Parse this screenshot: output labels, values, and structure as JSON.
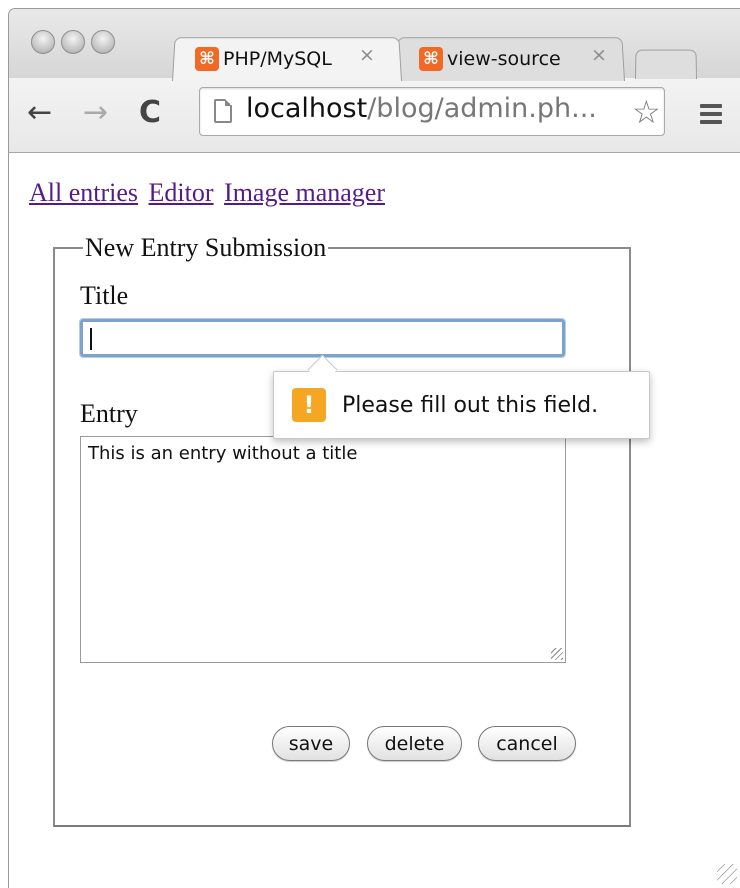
{
  "browser": {
    "tabs": [
      {
        "title": "PHP/MySQL",
        "favicon": "xampp-icon",
        "active": true,
        "close": "×"
      },
      {
        "title": "view-source",
        "favicon": "xampp-icon",
        "active": false,
        "close": "×"
      }
    ],
    "favicon_glyph": "⌘",
    "nav": {
      "back": "←",
      "forward": "→",
      "reload": "C"
    },
    "url": {
      "host": "localhost",
      "path": "/blog/admin.ph..."
    },
    "star_glyph": "☆"
  },
  "page": {
    "nav_links": [
      "All entries",
      "Editor",
      "Image manager"
    ],
    "form": {
      "legend": "New Entry Submission",
      "title_label": "Title",
      "title_value": "",
      "entry_label": "Entry",
      "entry_value": "This is an entry without a title",
      "buttons": {
        "save": "save",
        "delete": "delete",
        "cancel": "cancel"
      }
    },
    "validation_tooltip": {
      "icon": "!",
      "message": "Please fill out this field."
    }
  },
  "colors": {
    "link": "#551a8b",
    "favicon": "#f06a26",
    "warning": "#f5a623",
    "focus_ring": "#7da2ce"
  }
}
